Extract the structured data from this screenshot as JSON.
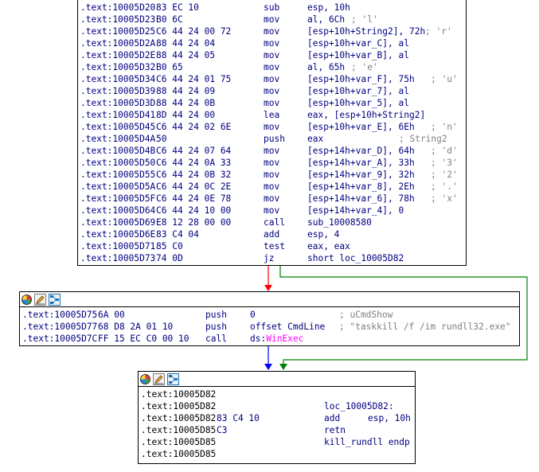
{
  "colors": {
    "edge_red": "#ff0000",
    "edge_green": "#008000",
    "edge_blue": "#0000ff",
    "address": "#000080",
    "comment": "#808080",
    "import": "#ff00ff"
  },
  "toolbar_icons": [
    "set-node-color-icon",
    "rename-node-icon",
    "graph-overview-icon"
  ],
  "block1": {
    "lines": [
      {
        "addr": ".text:10005D20",
        "bytes": "83 EC 10",
        "mnem": "sub",
        "ops": "esp, 10h",
        "cmt": ""
      },
      {
        "addr": ".text:10005D23",
        "bytes": "B0 6C",
        "mnem": "mov",
        "ops": "al, 6Ch",
        "cmt": "; 'l'"
      },
      {
        "addr": ".text:10005D25",
        "bytes": "C6 44 24 00 72",
        "mnem": "mov",
        "ops": "[esp+10h+String2], 72h",
        "cmt": "; 'r'"
      },
      {
        "addr": ".text:10005D2A",
        "bytes": "88 44 24 04",
        "mnem": "mov",
        "ops": "[esp+10h+var_C], al",
        "cmt": ""
      },
      {
        "addr": ".text:10005D2E",
        "bytes": "88 44 24 05",
        "mnem": "mov",
        "ops": "[esp+10h+var_B], al",
        "cmt": ""
      },
      {
        "addr": ".text:10005D32",
        "bytes": "B0 65",
        "mnem": "mov",
        "ops": "al, 65h",
        "cmt": "; 'e'"
      },
      {
        "addr": ".text:10005D34",
        "bytes": "C6 44 24 01 75",
        "mnem": "mov",
        "ops": "[esp+10h+var_F], 75h",
        "cmt": "; 'u'"
      },
      {
        "addr": ".text:10005D39",
        "bytes": "88 44 24 09",
        "mnem": "mov",
        "ops": "[esp+10h+var_7], al",
        "cmt": ""
      },
      {
        "addr": ".text:10005D3D",
        "bytes": "88 44 24 0B",
        "mnem": "mov",
        "ops": "[esp+10h+var_5], al",
        "cmt": ""
      },
      {
        "addr": ".text:10005D41",
        "bytes": "8D 44 24 00",
        "mnem": "lea",
        "ops": "eax, [esp+10h+String2]",
        "cmt": ""
      },
      {
        "addr": ".text:10005D45",
        "bytes": "C6 44 24 02 6E",
        "mnem": "mov",
        "ops": "[esp+10h+var_E], 6Eh",
        "cmt": "; 'n'"
      },
      {
        "addr": ".text:10005D4A",
        "bytes": "50",
        "mnem": "push",
        "ops": "eax",
        "cmt": "; String2"
      },
      {
        "addr": ".text:10005D4B",
        "bytes": "C6 44 24 07 64",
        "mnem": "mov",
        "ops": "[esp+14h+var_D], 64h",
        "cmt": "; 'd'"
      },
      {
        "addr": ".text:10005D50",
        "bytes": "C6 44 24 0A 33",
        "mnem": "mov",
        "ops": "[esp+14h+var_A], 33h",
        "cmt": "; '3'"
      },
      {
        "addr": ".text:10005D55",
        "bytes": "C6 44 24 0B 32",
        "mnem": "mov",
        "ops": "[esp+14h+var_9], 32h",
        "cmt": "; '2'"
      },
      {
        "addr": ".text:10005D5A",
        "bytes": "C6 44 24 0C 2E",
        "mnem": "mov",
        "ops": "[esp+14h+var_8], 2Eh",
        "cmt": "; '.'"
      },
      {
        "addr": ".text:10005D5F",
        "bytes": "C6 44 24 0E 78",
        "mnem": "mov",
        "ops": "[esp+14h+var_6], 78h",
        "cmt": "; 'x'"
      },
      {
        "addr": ".text:10005D64",
        "bytes": "C6 44 24 10 00",
        "mnem": "mov",
        "ops": "[esp+14h+var_4], 0",
        "cmt": ""
      },
      {
        "addr": ".text:10005D69",
        "bytes": "E8 12 28 00 00",
        "mnem": "call",
        "ops": "sub_10008580",
        "cmt": ""
      },
      {
        "addr": ".text:10005D6E",
        "bytes": "83 C4 04",
        "mnem": "add",
        "ops": "esp, 4",
        "cmt": ""
      },
      {
        "addr": ".text:10005D71",
        "bytes": "85 C0",
        "mnem": "test",
        "ops": "eax, eax",
        "cmt": ""
      },
      {
        "addr": ".text:10005D73",
        "bytes": "74 0D",
        "mnem": "jz",
        "ops": "short loc_10005D82",
        "cmt": ""
      }
    ]
  },
  "block2": {
    "lines": [
      {
        "addr": ".text:10005D75",
        "bytes": "6A 00",
        "mnem": "push",
        "ops": "0",
        "cmt": "; uCmdShow"
      },
      {
        "addr": ".text:10005D77",
        "bytes": "68 D8 2A 01 10",
        "mnem": "push",
        "ops": "offset CmdLine",
        "cmt": "; \"taskkill /f /im rundll32.exe\""
      },
      {
        "addr": ".text:10005D7C",
        "bytes": "FF 15 EC C0 00 10",
        "mnem": "call",
        "ops_prefix": "ds:",
        "ops": "WinExec",
        "cmt": ""
      }
    ]
  },
  "block3": {
    "lines": [
      {
        "addr": ".text:10005D82",
        "bytes": "",
        "mnem": "",
        "ops": ""
      },
      {
        "addr": ".text:10005D82",
        "bytes": "",
        "mnem": "loc_10005D82:",
        "ops": ""
      },
      {
        "addr": ".text:10005D82",
        "bytes": "83 C4 10",
        "mnem": "add",
        "ops": "esp, 10h"
      },
      {
        "addr": ".text:10005D85",
        "bytes": "C3",
        "mnem": "retn",
        "ops": ""
      },
      {
        "addr": ".text:10005D85",
        "bytes": "",
        "mnem": "kill_rundll endp",
        "ops": ""
      },
      {
        "addr": ".text:10005D85",
        "bytes": "",
        "mnem": "",
        "ops": ""
      }
    ]
  }
}
